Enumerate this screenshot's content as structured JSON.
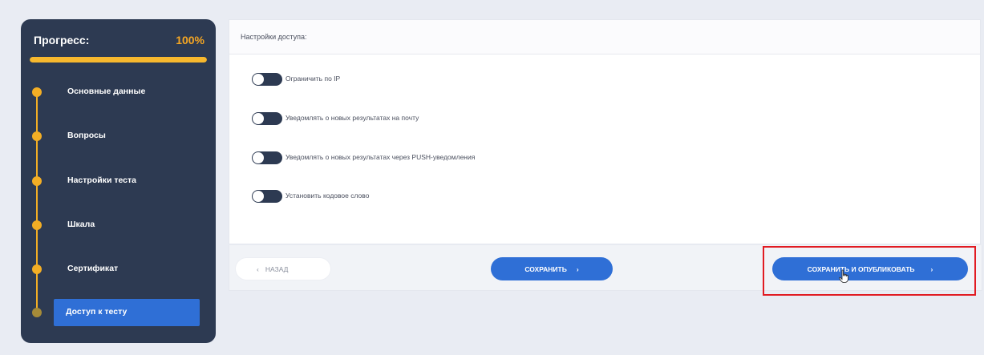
{
  "sidebar": {
    "title": "Прогресс:",
    "percent": "100%",
    "progress_fraction": 1.0,
    "items": [
      {
        "label": "Основные данные"
      },
      {
        "label": "Вопросы"
      },
      {
        "label": "Настройки теста"
      },
      {
        "label": "Шкала"
      },
      {
        "label": "Сертификат"
      },
      {
        "label": "Доступ к тесту",
        "active": true
      }
    ]
  },
  "card": {
    "title": "Настройки доступа:",
    "settings": [
      {
        "label": "Ограничить по IP",
        "enabled": false
      },
      {
        "label": "Уведомлять о новых результатах на почту",
        "enabled": false
      },
      {
        "label": "Уведомлять о новых результатах через PUSH-уведомления",
        "enabled": false
      },
      {
        "label": "Установить кодовое слово",
        "enabled": false
      }
    ]
  },
  "footer": {
    "back_label": "НАЗАД",
    "save_label": "СОХРАНИТЬ",
    "publish_label": "СОХРАНИТЬ И ОПУБЛИКОВАТЬ"
  },
  "colors": {
    "accent": "#2f6fd6",
    "sidebar_bg": "#2d3a52",
    "progress": "#f3ae25",
    "highlight": "#e11b22"
  }
}
